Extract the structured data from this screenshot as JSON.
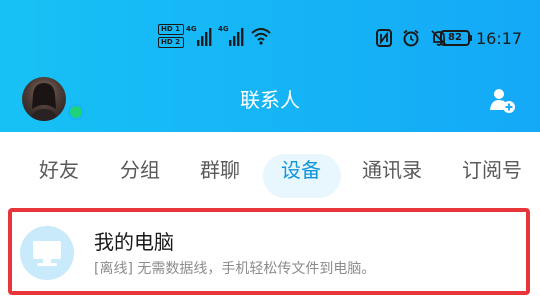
{
  "status_bar": {
    "hd1": "HD 1",
    "hd2": "HD 2",
    "net1": "4G",
    "net2": "4G",
    "battery_level": "82",
    "time": "16:17",
    "icons": [
      "hd-badge-icon",
      "signal-icon",
      "wifi-icon",
      "nfc-icon",
      "alarm-icon",
      "mute-icon",
      "battery-icon"
    ]
  },
  "header": {
    "title": "联系人",
    "avatar": "avatar",
    "online_color": "#1fd27a",
    "right_icon": "add-contact-icon"
  },
  "tabs": [
    {
      "label": "好友",
      "active": false
    },
    {
      "label": "分组",
      "active": false
    },
    {
      "label": "群聊",
      "active": false
    },
    {
      "label": "设备",
      "active": true
    },
    {
      "label": "通讯录",
      "active": false
    },
    {
      "label": "订阅号",
      "active": false
    }
  ],
  "device": {
    "title": "我的电脑",
    "subtitle": "[离线] 无需数据线，手机轻松传文件到电脑。",
    "icon": "computer-icon"
  },
  "colors": {
    "header_gradient_start": "#17c1f5",
    "header_gradient_end": "#14a9f7",
    "active_tab": "#1296db",
    "active_tab_bg": "#e7f7fd",
    "highlight_border": "#e8353a"
  }
}
